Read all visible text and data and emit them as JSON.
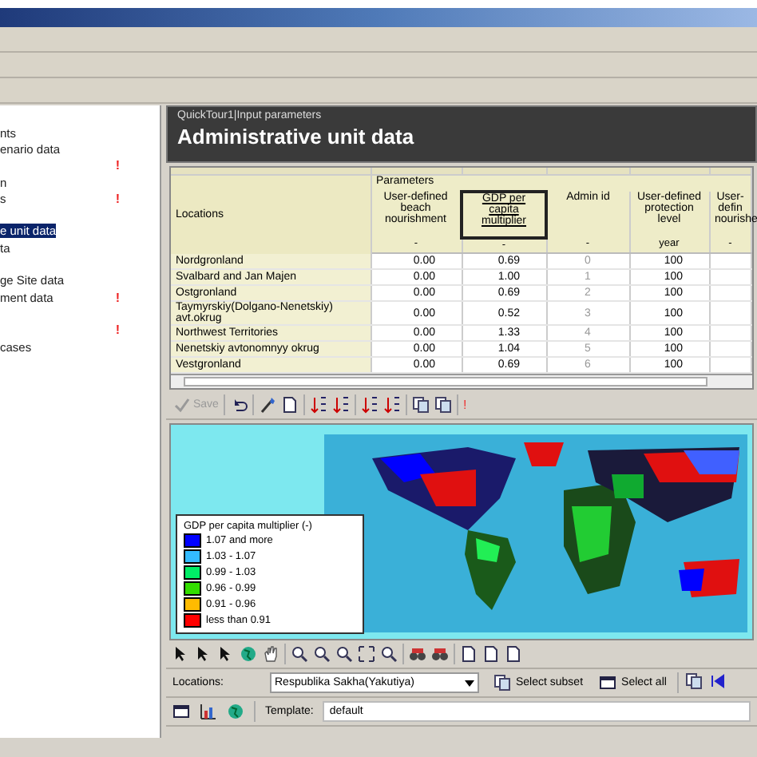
{
  "sidebar": {
    "items": [
      {
        "kind": "item",
        "label": "nts",
        "selected": false
      },
      {
        "kind": "item",
        "label": "enario data",
        "selected": false
      },
      {
        "kind": "flag",
        "flag": "!"
      },
      {
        "kind": "item",
        "label": "n",
        "selected": false
      },
      {
        "kind": "item",
        "label": "s",
        "selected": false,
        "flag": "!"
      },
      {
        "kind": "spacer"
      },
      {
        "kind": "item",
        "label": "e unit data",
        "selected": true
      },
      {
        "kind": "item",
        "label": "ta",
        "selected": false
      },
      {
        "kind": "spacer"
      },
      {
        "kind": "item",
        "label": "ge Site data",
        "selected": false
      },
      {
        "kind": "item",
        "label": "ment data",
        "selected": false,
        "flag": "!"
      },
      {
        "kind": "spacer"
      },
      {
        "kind": "flag",
        "flag": "!"
      },
      {
        "kind": "item",
        "label": "cases",
        "selected": false
      }
    ]
  },
  "panel": {
    "path": "QuickTour1|Input parameters",
    "title": "Administrative unit data"
  },
  "table": {
    "group": "Parameters",
    "location_header": "Locations",
    "columns": [
      {
        "label": "User-defined beach nourishment",
        "unit": "-",
        "selected": false
      },
      {
        "label": "GDP per capita multiplier",
        "unit": "-",
        "selected": true
      },
      {
        "label": "Admin id",
        "unit": "-",
        "selected": false
      },
      {
        "label": "User-defined protection level",
        "unit": "year",
        "selected": false
      },
      {
        "label": "User-defin nourishe",
        "unit": "-",
        "selected": false
      }
    ],
    "rows": [
      {
        "location": "Nordgronland",
        "values": [
          "0.00",
          "0.69",
          "0",
          "100"
        ]
      },
      {
        "location": "Svalbard and Jan Majen",
        "values": [
          "0.00",
          "1.00",
          "1",
          "100"
        ]
      },
      {
        "location": "Ostgronland",
        "values": [
          "0.00",
          "0.69",
          "2",
          "100"
        ]
      },
      {
        "location": "Taymyrskiy(Dolgano-Nenetskiy) avt.okrug",
        "values": [
          "0.00",
          "0.52",
          "3",
          "100"
        ]
      },
      {
        "location": "Northwest Territories",
        "values": [
          "0.00",
          "1.33",
          "4",
          "100"
        ]
      },
      {
        "location": "Nenetskiy avtonomnyy okrug",
        "values": [
          "0.00",
          "1.04",
          "5",
          "100"
        ]
      },
      {
        "location": "Vestgronland",
        "values": [
          "0.00",
          "0.69",
          "6",
          "100"
        ]
      }
    ]
  },
  "toolbar": {
    "save": {
      "label": "Save",
      "disabled": true
    },
    "warning": "!"
  },
  "legend": {
    "title": "GDP per capita multiplier (-)",
    "items": [
      {
        "label": "1.07 and more",
        "color": "#0000ff"
      },
      {
        "label": "1.03 - 1.07",
        "color": "#33bbff"
      },
      {
        "label": "0.99 - 1.03",
        "color": "#00ee66"
      },
      {
        "label": "0.96 - 0.99",
        "color": "#33dd00"
      },
      {
        "label": "0.91 - 0.96",
        "color": "#ffbb00"
      },
      {
        "label": "less than 0.91",
        "color": "#ff0000"
      }
    ]
  },
  "locations": {
    "label": "Locations:",
    "value": "Respublika Sakha(Yakutiya)",
    "buttons": [
      "Select subset",
      "Select all"
    ]
  },
  "template": {
    "label": "Template:",
    "value": "default"
  }
}
